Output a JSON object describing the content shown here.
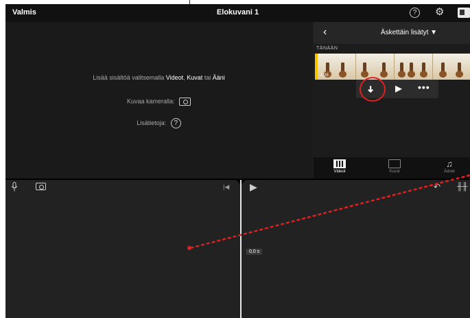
{
  "topbar": {
    "done_label": "Valmis",
    "project_title": "Elokuvani 1",
    "help_glyph": "?",
    "gear_glyph": "⚙"
  },
  "viewer": {
    "hint_prefix": "Lisää sisältöä valitsemalla",
    "hint_videos": "Videot",
    "hint_sep": ",",
    "hint_photos": "Kuvat",
    "hint_or": "tai",
    "hint_audio": "Ääni",
    "camera_label": "Kuvaa kameralla:",
    "more_info_label": "Lisätietoja:",
    "more_info_glyph": "?"
  },
  "browser": {
    "back_glyph": "‹",
    "category_title": "Äskettäin lisätyt ▼",
    "section_label": "TÄNÄÄN",
    "clip_duration": "1:26",
    "add_glyph": "➜",
    "play_glyph": "▶",
    "more_glyph": "•••",
    "tabs": [
      {
        "label": "Videot",
        "selected": true
      },
      {
        "label": "Kuvat",
        "selected": false
      },
      {
        "label": "Äänet",
        "selected": false,
        "icon_glyph": "♫"
      }
    ]
  },
  "timeline": {
    "mic_glyph": "🎙",
    "skip_back_glyph": "|◀",
    "play_glyph": "▶",
    "undo_glyph": "↶",
    "wave_glyph": "╫╫",
    "time_readout": "0,0 s"
  },
  "icons": {
    "done": "text-button",
    "help": "question-circle-icon",
    "settings": "gear-icon",
    "export": "export-icon",
    "camera": "camera-icon",
    "microphone": "microphone-icon",
    "add_clip": "arrow-down-icon",
    "undo": "undo-icon",
    "audio_waveform": "waveform-icon"
  },
  "colors": {
    "accent_selection": "#f4c400",
    "annotation_red": "#e02020",
    "background": "#1c1c1c"
  }
}
